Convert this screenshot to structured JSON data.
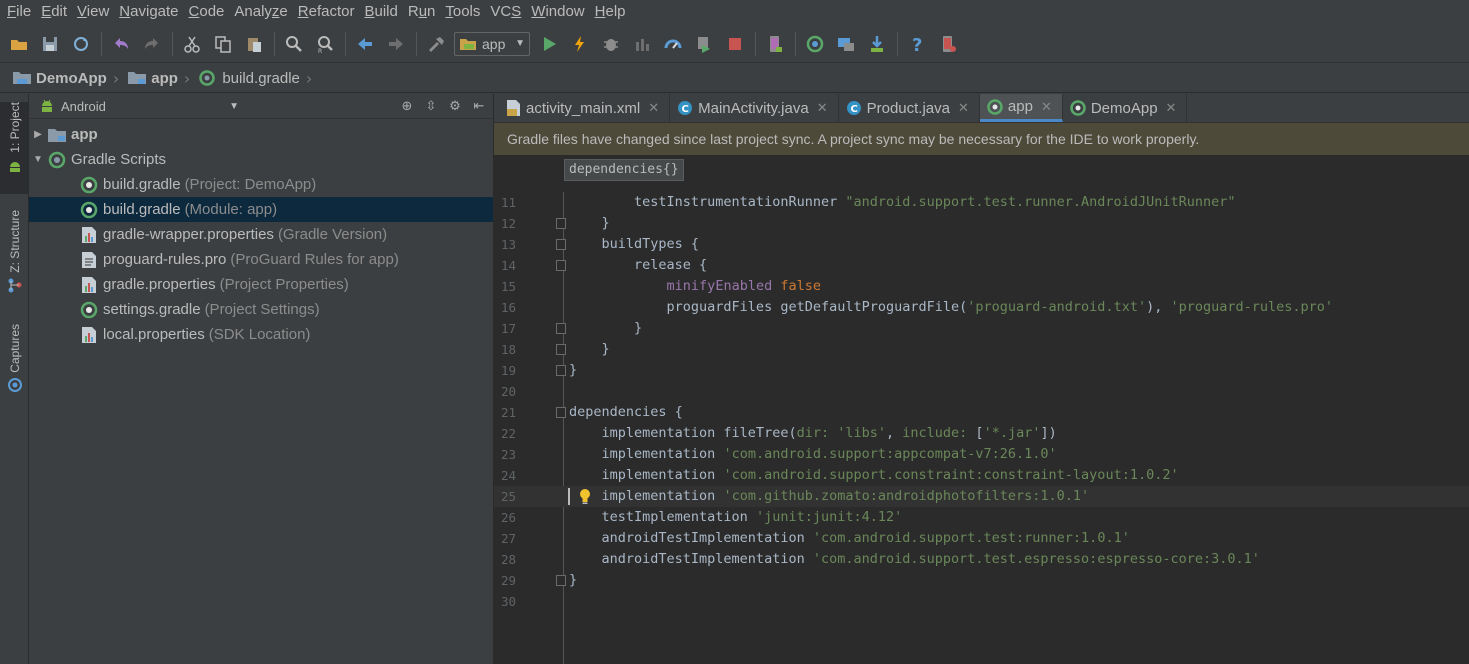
{
  "menubar": {
    "items": [
      {
        "mn": "F",
        "rest": "ile"
      },
      {
        "mn": "E",
        "rest": "dit"
      },
      {
        "mn": "V",
        "rest": "iew"
      },
      {
        "mn": "N",
        "rest": "avigate"
      },
      {
        "mn": "C",
        "rest": "ode"
      },
      {
        "pre": "Analy",
        "mn": "z",
        "rest": "e"
      },
      {
        "mn": "R",
        "rest": "efactor"
      },
      {
        "mn": "B",
        "rest": "uild"
      },
      {
        "pre": "R",
        "mn": "u",
        "rest": "n"
      },
      {
        "mn": "T",
        "rest": "ools"
      },
      {
        "pre": "VC",
        "mn": "S",
        "rest": ""
      },
      {
        "mn": "W",
        "rest": "indow"
      },
      {
        "mn": "H",
        "rest": "elp"
      }
    ]
  },
  "toolbar": {
    "run_config": "app",
    "icons": [
      "open-folder-icon",
      "save-icon",
      "sync-icon",
      "undo-icon",
      "redo-icon",
      "cut-icon",
      "copy-icon",
      "paste-icon",
      "find-icon",
      "replace-icon",
      "back-icon",
      "forward-icon",
      "make-project-icon",
      "run-icon",
      "apply-changes-icon",
      "debug-icon",
      "attach-debugger-icon",
      "profile-icon",
      "run-coverage-icon",
      "stop-icon",
      "avd-manager-icon",
      "sync-gradle-icon",
      "project-structure-icon",
      "sdk-manager-icon",
      "help-icon",
      "device-monitor-icon"
    ]
  },
  "navbar": {
    "crumbs": [
      "DemoApp",
      "app",
      "build.gradle"
    ]
  },
  "side_tabs": {
    "project": "1: Project",
    "structure": "Z: Structure",
    "captures": "Captures"
  },
  "project_panel": {
    "view": "Android",
    "tree": [
      {
        "label": "app",
        "hint": "",
        "level": 0,
        "arrow": "▶"
      },
      {
        "label": "Gradle Scripts",
        "hint": "",
        "level": 0,
        "arrow": "▼"
      },
      {
        "label": "build.gradle",
        "hint": "(Project: DemoApp)",
        "level": 1
      },
      {
        "label": "build.gradle",
        "hint": "(Module: app)",
        "level": 1
      },
      {
        "label": "gradle-wrapper.properties",
        "hint": "(Gradle Version)",
        "level": 1
      },
      {
        "label": "proguard-rules.pro",
        "hint": "(ProGuard Rules for app)",
        "level": 1
      },
      {
        "label": "gradle.properties",
        "hint": "(Project Properties)",
        "level": 1
      },
      {
        "label": "settings.gradle",
        "hint": "(Project Settings)",
        "level": 1
      },
      {
        "label": "local.properties",
        "hint": "(SDK Location)",
        "level": 1
      }
    ]
  },
  "editor": {
    "tabs": [
      "activity_main.xml",
      "MainActivity.java",
      "Product.java",
      "app",
      "DemoApp"
    ],
    "active_tab": "app",
    "banner": "Gradle files have changed since last project sync. A project sync may be necessary for the IDE to work properly.",
    "code_crumb": "dependencies{}",
    "line_numbers": [
      "11",
      "12",
      "13",
      "14",
      "15",
      "16",
      "17",
      "18",
      "19",
      "20",
      "21",
      "22",
      "23",
      "24",
      "25",
      "26",
      "27",
      "28",
      "29",
      "30"
    ]
  },
  "colors": {
    "keyword": "#cc7832",
    "string": "#6a8759",
    "property": "#9876aa",
    "text": "#a9b7c6",
    "selection": "#0d293e",
    "banner": "#4d4a3a"
  }
}
